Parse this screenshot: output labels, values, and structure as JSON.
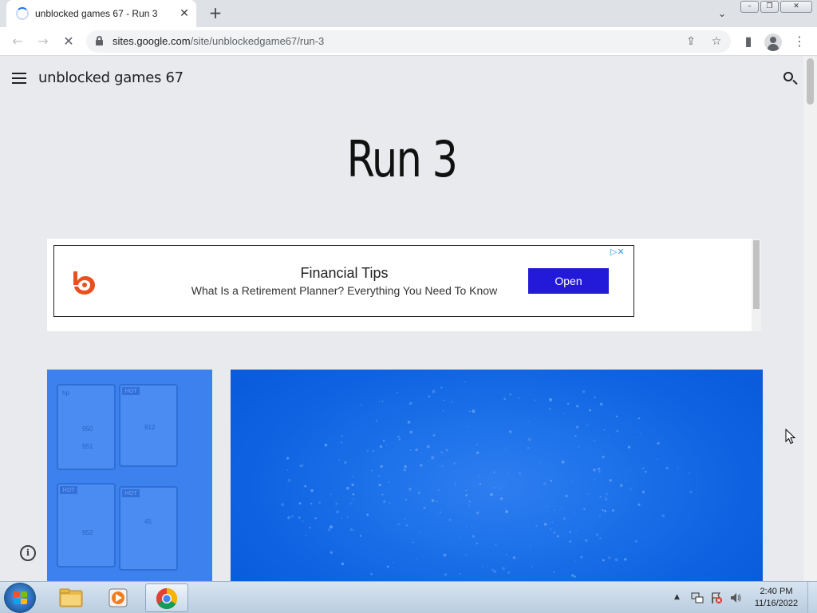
{
  "browser": {
    "tab": {
      "title": "unblocked games 67 - Run 3",
      "close_glyph": "✕"
    },
    "new_tab_glyph": "+",
    "tab_search_glyph": "⌄",
    "window_controls": {
      "minimize": "–",
      "restore": "❐",
      "close": "✕"
    },
    "toolbar": {
      "back_glyph": "←",
      "forward_glyph": "→",
      "stop_glyph": "✕",
      "url_host": "sites.google.com",
      "url_path": "/site/unblockedgame67/run-3",
      "share_glyph": "⇪",
      "star_glyph": "☆",
      "sidepanel_glyph": "▮",
      "menu_glyph": "⋮"
    }
  },
  "site": {
    "title": "unblocked games 67",
    "page_heading": "Run 3"
  },
  "ad": {
    "headline": "Financial Tips",
    "subtext": "What Is a Retirement Planner? Everything You Need To Know",
    "cta": "Open",
    "adchoices": "▷✕",
    "brand_color": "#e8501e",
    "cta_color": "#2319d8"
  },
  "printer_ad": {
    "cartridges": [
      "950",
      "951",
      "912",
      "952",
      "45"
    ],
    "badge": "HOT",
    "brand": "hp"
  },
  "info_glyph": "i",
  "taskbar": {
    "tray_arrow": "▲",
    "clock_time": "2:40 PM",
    "clock_date": "11/16/2022"
  }
}
